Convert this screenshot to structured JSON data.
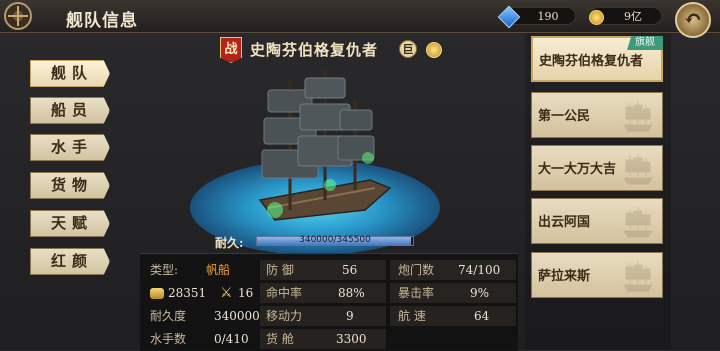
{
  "header": {
    "title": "舰队信息",
    "gems": "190",
    "gold": "9亿",
    "back_icon": "↶"
  },
  "nav": {
    "items": [
      "舰队",
      "船员",
      "水手",
      "货物",
      "天赋",
      "红颜"
    ],
    "active": 0
  },
  "ship": {
    "battle_badge": "战",
    "name": "史陶芬伯格复仇者",
    "size_badge": "巨",
    "durability_label": "耐久:",
    "durability_value": "340000/345500",
    "durability_fraction": 0.984
  },
  "stats": {
    "type_label": "类型:",
    "type_value": "帆船",
    "cannon_value": "28351",
    "crew_value": "16",
    "durability_label": "耐久度",
    "durability_value": "340000",
    "sailors_label": "水手数",
    "sailors_value": "0/410",
    "defense_label": "防 御",
    "defense_value": "56",
    "hit_label": "命中率",
    "hit_value": "88%",
    "move_label": "移动力",
    "move_value": "9",
    "cargo_label": "货 舱",
    "cargo_value": "3300",
    "guns_label": "炮门数",
    "guns_value": "74/100",
    "crit_label": "暴击率",
    "crit_value": "9%",
    "speed_label": "航 速",
    "speed_value": "64"
  },
  "fleet": {
    "flagship_tag": "旗舰",
    "ships": [
      "史陶芬伯格复仇者",
      "第一公民",
      "大一大万大吉",
      "出云阿国",
      "萨拉来斯"
    ]
  },
  "colors": {
    "accent_orange": "#f2a33a",
    "flagship_green": "#3e9a7a",
    "sea_blue": "#2893c5"
  }
}
